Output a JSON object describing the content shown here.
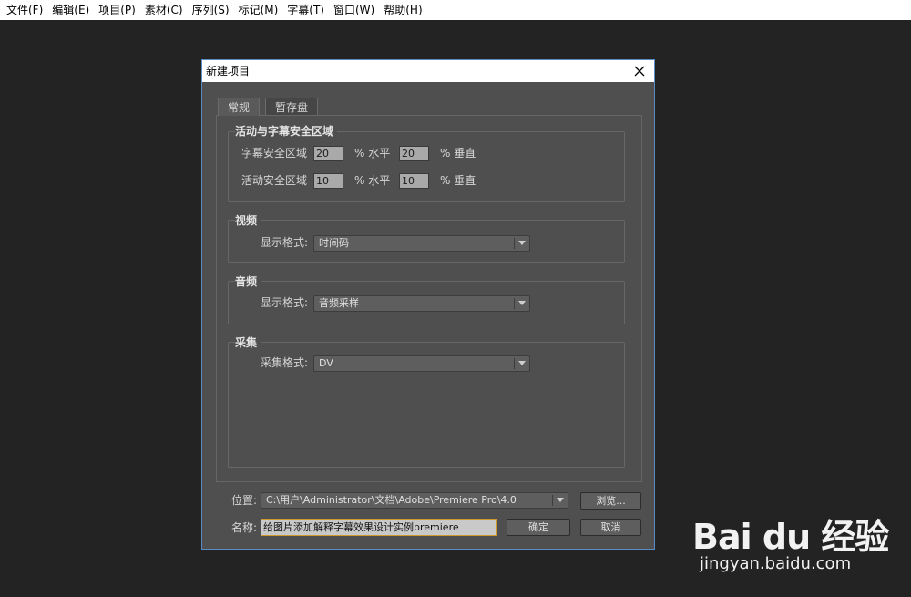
{
  "menubar": {
    "items": [
      "文件(F)",
      "编辑(E)",
      "项目(P)",
      "素材(C)",
      "序列(S)",
      "标记(M)",
      "字幕(T)",
      "窗口(W)",
      "帮助(H)"
    ]
  },
  "dialog": {
    "title": "新建项目",
    "tabs": [
      {
        "label": "常规",
        "active": true
      },
      {
        "label": "暂存盘",
        "active": false
      }
    ],
    "safe_area": {
      "title": "活动与字幕安全区域",
      "title_safe_label": "字幕安全区域",
      "title_safe_h": "20",
      "title_safe_v": "20",
      "action_safe_label": "活动安全区域",
      "action_safe_h": "10",
      "action_safe_v": "10",
      "horiz_unit": "% 水平",
      "vert_unit": "% 垂直"
    },
    "video": {
      "title": "视频",
      "format_label": "显示格式:",
      "format_value": "时间码"
    },
    "audio": {
      "title": "音频",
      "format_label": "显示格式:",
      "format_value": "音频采样"
    },
    "capture": {
      "title": "采集",
      "format_label": "采集格式:",
      "format_value": "DV"
    },
    "location": {
      "label": "位置:",
      "value": "C:\\用户\\Administrator\\文档\\Adobe\\Premiere Pro\\4.0",
      "browse_label": "浏览..."
    },
    "name": {
      "label": "名称:",
      "value": "给图片添加解释字幕效果设计实例premiere",
      "ok_label": "确定",
      "cancel_label": "取消"
    }
  },
  "watermark": {
    "brand": "Bai du 经验",
    "url": "jingyan.baidu.com"
  }
}
